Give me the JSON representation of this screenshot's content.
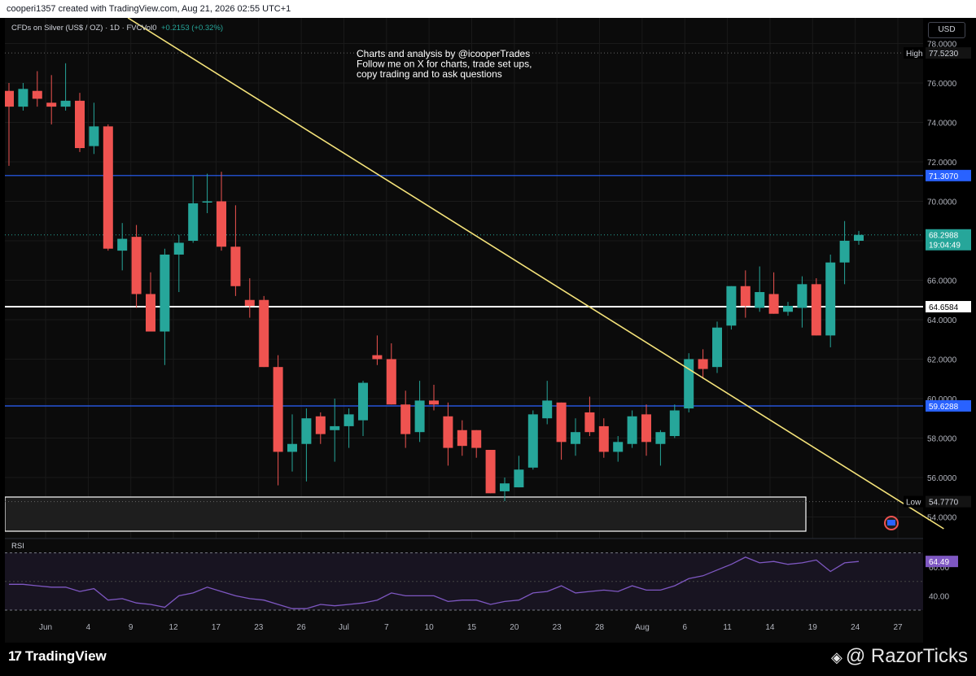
{
  "header": {
    "watermark": "cooperi1357 created with TradingView.com, Aug 21, 2026 02:55 UTC+1"
  },
  "symbol": {
    "name": "CFDs on Silver (US$ / OZ) · 1D · FVC",
    "volume_label": "Vol0",
    "change": "+0.2153 (+0.32%)"
  },
  "currency_button": "USD",
  "annotation": {
    "lines": [
      "Charts and analysis by @icooperTrades",
      "Follow me on X for charts, trade set ups,",
      "copy trading and to ask questions"
    ]
  },
  "rsi_label": "RSI",
  "rsi_value": "64.49",
  "footer": {
    "tradingview": "TradingView",
    "razorticks": "@ RazorTicks"
  },
  "colors": {
    "up": "#26a69a",
    "down": "#ef5350",
    "trendline": "#f5e37a",
    "level_blue": "#2962ff",
    "level_white": "#ffffff",
    "rsi_line": "#7e57c2"
  },
  "chart_data": {
    "type": "candlestick",
    "ylim": [
      53.4,
      79.3
    ],
    "y_ticks": [
      "78.0000",
      "76.0000",
      "74.0000",
      "72.0000",
      "70.0000",
      "68.0000",
      "66.0000",
      "64.0000",
      "62.0000",
      "60.0000",
      "58.0000",
      "56.0000",
      "54.0000"
    ],
    "x_ticks": [
      "Jun",
      "4",
      "9",
      "12",
      "17",
      "23",
      "26",
      "Jul",
      "7",
      "10",
      "15",
      "20",
      "23",
      "28",
      "Aug",
      "6",
      "11",
      "14",
      "19",
      "24",
      "27"
    ],
    "candles": [
      {
        "o": 75.6,
        "h": 76.0,
        "l": 71.8,
        "c": 74.8
      },
      {
        "o": 74.8,
        "h": 76.0,
        "l": 74.6,
        "c": 75.7
      },
      {
        "o": 75.6,
        "h": 76.6,
        "l": 74.8,
        "c": 75.2
      },
      {
        "o": 75.0,
        "h": 76.4,
        "l": 73.9,
        "c": 74.8
      },
      {
        "o": 74.8,
        "h": 77.0,
        "l": 74.6,
        "c": 75.1
      },
      {
        "o": 75.1,
        "h": 75.5,
        "l": 72.5,
        "c": 72.7
      },
      {
        "o": 72.8,
        "h": 75.0,
        "l": 72.4,
        "c": 73.8
      },
      {
        "o": 73.8,
        "h": 73.9,
        "l": 67.5,
        "c": 67.6
      },
      {
        "o": 67.5,
        "h": 68.9,
        "l": 66.5,
        "c": 68.1
      },
      {
        "o": 68.2,
        "h": 68.8,
        "l": 64.6,
        "c": 65.3
      },
      {
        "o": 65.3,
        "h": 66.4,
        "l": 63.4,
        "c": 63.4
      },
      {
        "o": 63.4,
        "h": 67.6,
        "l": 61.7,
        "c": 67.3
      },
      {
        "o": 67.3,
        "h": 68.3,
        "l": 65.4,
        "c": 67.9
      },
      {
        "o": 68.0,
        "h": 71.3,
        "l": 67.9,
        "c": 69.9
      },
      {
        "o": 70.0,
        "h": 71.4,
        "l": 69.4,
        "c": 70.0
      },
      {
        "o": 70.0,
        "h": 71.5,
        "l": 67.5,
        "c": 67.7
      },
      {
        "o": 67.7,
        "h": 69.8,
        "l": 65.2,
        "c": 65.7
      },
      {
        "o": 65.0,
        "h": 66.1,
        "l": 64.1,
        "c": 64.7
      },
      {
        "o": 65.0,
        "h": 65.2,
        "l": 61.6,
        "c": 61.6
      },
      {
        "o": 61.6,
        "h": 62.2,
        "l": 55.6,
        "c": 57.3
      },
      {
        "o": 57.3,
        "h": 59.2,
        "l": 56.3,
        "c": 57.7
      },
      {
        "o": 57.7,
        "h": 59.5,
        "l": 55.8,
        "c": 59.0
      },
      {
        "o": 59.1,
        "h": 59.3,
        "l": 57.7,
        "c": 58.2
      },
      {
        "o": 58.4,
        "h": 60.0,
        "l": 56.8,
        "c": 58.6
      },
      {
        "o": 58.6,
        "h": 59.5,
        "l": 57.5,
        "c": 59.2
      },
      {
        "o": 58.9,
        "h": 60.9,
        "l": 58.1,
        "c": 60.8
      },
      {
        "o": 62.2,
        "h": 63.2,
        "l": 61.7,
        "c": 62.0
      },
      {
        "o": 62.0,
        "h": 62.8,
        "l": 59.7,
        "c": 59.7
      },
      {
        "o": 59.7,
        "h": 60.4,
        "l": 57.5,
        "c": 58.2
      },
      {
        "o": 58.3,
        "h": 60.9,
        "l": 57.8,
        "c": 59.9
      },
      {
        "o": 59.9,
        "h": 60.7,
        "l": 59.4,
        "c": 59.7
      },
      {
        "o": 59.1,
        "h": 59.8,
        "l": 56.6,
        "c": 57.5
      },
      {
        "o": 58.4,
        "h": 58.9,
        "l": 57.1,
        "c": 57.6
      },
      {
        "o": 58.4,
        "h": 58.4,
        "l": 57.0,
        "c": 57.5
      },
      {
        "o": 57.4,
        "h": 57.4,
        "l": 55.2,
        "c": 55.2
      },
      {
        "o": 55.3,
        "h": 56.0,
        "l": 54.8,
        "c": 55.7
      },
      {
        "o": 55.5,
        "h": 57.1,
        "l": 55.5,
        "c": 56.4
      },
      {
        "o": 56.5,
        "h": 59.4,
        "l": 56.4,
        "c": 59.2
      },
      {
        "o": 59.0,
        "h": 60.9,
        "l": 58.7,
        "c": 59.9
      },
      {
        "o": 59.8,
        "h": 59.8,
        "l": 56.9,
        "c": 57.8
      },
      {
        "o": 57.7,
        "h": 59.0,
        "l": 57.1,
        "c": 58.3
      },
      {
        "o": 59.3,
        "h": 60.1,
        "l": 58.1,
        "c": 58.3
      },
      {
        "o": 58.6,
        "h": 59.0,
        "l": 57.0,
        "c": 57.3
      },
      {
        "o": 57.3,
        "h": 58.1,
        "l": 56.8,
        "c": 57.8
      },
      {
        "o": 57.7,
        "h": 59.4,
        "l": 57.5,
        "c": 59.1
      },
      {
        "o": 59.2,
        "h": 59.7,
        "l": 57.1,
        "c": 57.8
      },
      {
        "o": 57.7,
        "h": 58.4,
        "l": 56.6,
        "c": 58.3
      },
      {
        "o": 58.1,
        "h": 59.7,
        "l": 58.0,
        "c": 59.4
      },
      {
        "o": 59.5,
        "h": 62.3,
        "l": 59.3,
        "c": 62.0
      },
      {
        "o": 62.0,
        "h": 62.5,
        "l": 61.0,
        "c": 61.5
      },
      {
        "o": 61.6,
        "h": 63.9,
        "l": 61.3,
        "c": 63.6
      },
      {
        "o": 63.7,
        "h": 65.7,
        "l": 63.5,
        "c": 65.7
      },
      {
        "o": 65.7,
        "h": 66.5,
        "l": 64.1,
        "c": 64.7
      },
      {
        "o": 64.6,
        "h": 66.7,
        "l": 64.4,
        "c": 65.4
      },
      {
        "o": 65.3,
        "h": 66.4,
        "l": 64.3,
        "c": 64.3
      },
      {
        "o": 64.4,
        "h": 64.9,
        "l": 64.2,
        "c": 64.7
      },
      {
        "o": 64.6,
        "h": 66.2,
        "l": 63.6,
        "c": 65.8
      },
      {
        "o": 65.8,
        "h": 66.1,
        "l": 63.2,
        "c": 63.2
      },
      {
        "o": 63.2,
        "h": 67.3,
        "l": 62.6,
        "c": 66.9
      },
      {
        "o": 66.9,
        "h": 69.0,
        "l": 65.8,
        "c": 68.0
      },
      {
        "o": 68.0,
        "h": 68.5,
        "l": 67.8,
        "c": 68.3
      }
    ],
    "levels": [
      {
        "value": 77.523,
        "label": "High",
        "price": "77.5230",
        "kind": "dotted"
      },
      {
        "value": 71.307,
        "label": "",
        "price": "71.3070",
        "kind": "blue"
      },
      {
        "value": 68.2988,
        "label": "",
        "price": "68.2988",
        "countdown": "19:04:49",
        "kind": "current"
      },
      {
        "value": 64.6584,
        "label": "",
        "price": "64.6584",
        "kind": "white"
      },
      {
        "value": 59.6288,
        "label": "",
        "price": "59.6288",
        "kind": "blue"
      },
      {
        "value": 54.777,
        "label": "Low",
        "price": "54.7770",
        "kind": "dotted"
      }
    ],
    "trendline": {
      "from_candle": 8.4,
      "from_value": 79.3,
      "to_candle": 66.0,
      "to_value": 53.4
    },
    "rsi": {
      "ylim": [
        30,
        80
      ],
      "ticks": [
        "60.00",
        "40.00"
      ],
      "bands": [
        70,
        30
      ],
      "values": [
        48,
        48,
        47,
        46,
        46,
        43,
        45,
        37,
        38,
        35,
        34,
        32,
        40,
        42,
        46,
        43,
        40,
        38,
        37,
        34,
        31,
        31,
        34,
        33,
        34,
        35,
        37,
        42,
        40,
        40,
        40,
        36,
        37,
        37,
        34,
        36,
        37,
        42,
        43,
        47,
        42,
        43,
        44,
        43,
        47,
        44,
        44,
        47,
        52,
        54,
        58,
        62,
        67,
        63,
        64,
        62,
        63,
        65,
        57,
        63,
        64
      ]
    }
  }
}
